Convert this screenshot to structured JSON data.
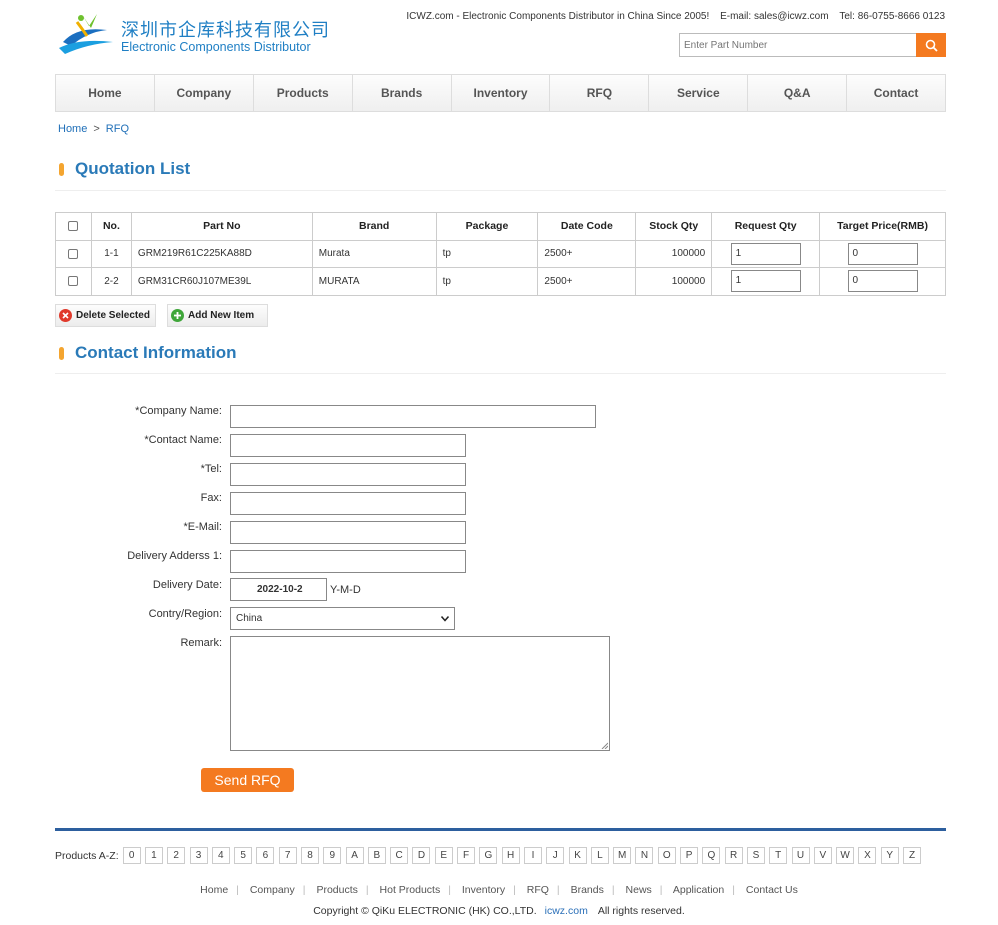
{
  "header": {
    "logo_cn": "深圳市企库科技有限公司",
    "logo_en": "Electronic Components Distributor",
    "tagline": "ICWZ.com - Electronic Components Distributor in China Since 2005!",
    "email": "E-mail: sales@icwz.com",
    "tel": "Tel: 86-0755-8666 0123",
    "search_placeholder": "Enter Part Number"
  },
  "nav": [
    "Home",
    "Company",
    "Products",
    "Brands",
    "Inventory",
    "RFQ",
    "Service",
    "Q&A",
    "Contact"
  ],
  "breadcrumb": {
    "home": "Home",
    "sep": ">",
    "current": "RFQ"
  },
  "quotation": {
    "title": "Quotation List",
    "columns": [
      "No.",
      "Part No",
      "Brand",
      "Package",
      "Date Code",
      "Stock Qty",
      "Request Qty",
      "Target Price(RMB)"
    ],
    "rows": [
      {
        "no": "1-1",
        "part": "GRM219R61C225KA88D",
        "brand": "Murata",
        "package": "tp",
        "date_code": "2500+",
        "stock": "100000",
        "req_qty": "1",
        "target": "0"
      },
      {
        "no": "2-2",
        "part": "GRM31CR60J107ME39L",
        "brand": "MURATA",
        "package": "tp",
        "date_code": "2500+",
        "stock": "100000",
        "req_qty": "1",
        "target": "0"
      }
    ],
    "delete_label": "Delete Selected",
    "add_label": "Add New Item"
  },
  "contact": {
    "title": "Contact Information",
    "company_label": "*Company Name:",
    "contact_label": "*Contact Name:",
    "tel_label": "*Tel:",
    "fax_label": "Fax:",
    "email_label": "*E-Mail:",
    "address_label": "Delivery Adderss 1:",
    "date_label": "Delivery Date:",
    "date_value": "2022-10-2",
    "date_hint": "Y-M-D",
    "region_label": "Contry/Region:",
    "region_value": "China",
    "remark_label": "Remark:",
    "send_label": "Send RFQ"
  },
  "footer": {
    "az_label": "Products A-Z:",
    "az": [
      "0",
      "1",
      "2",
      "3",
      "4",
      "5",
      "6",
      "7",
      "8",
      "9",
      "A",
      "B",
      "C",
      "D",
      "E",
      "F",
      "G",
      "H",
      "I",
      "J",
      "K",
      "L",
      "M",
      "N",
      "O",
      "P",
      "Q",
      "R",
      "S",
      "T",
      "U",
      "V",
      "W",
      "X",
      "Y",
      "Z"
    ],
    "links": [
      "Home",
      "Company",
      "Products",
      "Hot Products",
      "Inventory",
      "RFQ",
      "Brands",
      "News",
      "Application",
      "Contact Us"
    ],
    "copyright": "Copyright © QiKu ELECTRONIC (HK) CO.,LTD.",
    "site": "icwz.com",
    "rights": "All rights reserved."
  },
  "colors": {
    "accent": "#f47a20",
    "brand_blue": "#2a7ab8",
    "footer_line": "#2d5f9e"
  }
}
